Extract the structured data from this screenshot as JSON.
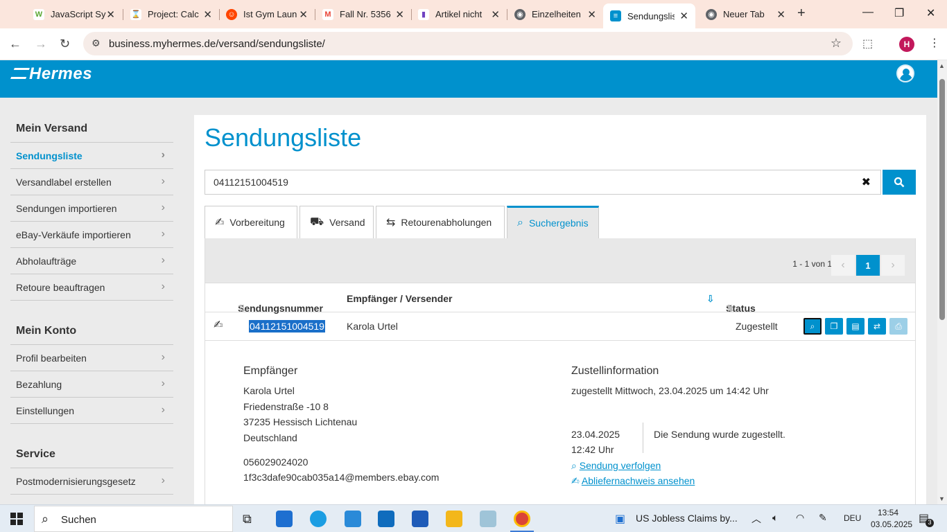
{
  "browser": {
    "tabs": [
      {
        "label": "JavaScript Sy",
        "color": "#5aa832",
        "glyph": "W"
      },
      {
        "label": "Project: Calc",
        "color": "#d9a441",
        "glyph": "P"
      },
      {
        "label": "Ist Gym Laun",
        "color": "#ff4500",
        "glyph": "r"
      },
      {
        "label": "Fall Nr. 5356",
        "color": "#ea4335",
        "glyph": "M"
      },
      {
        "label": "Artikel nicht",
        "color": "#6f42c1",
        "glyph": "A"
      },
      {
        "label": "Einzelheiten",
        "color": "#5f6368",
        "glyph": "G"
      },
      {
        "label": "Sendungsliste",
        "color": "#0091cd",
        "glyph": "H"
      },
      {
        "label": "Neuer Tab",
        "color": "#5f6368",
        "glyph": "G"
      }
    ],
    "url": "business.myhermes.de/versand/sendungsliste/",
    "profile_initial": "H"
  },
  "site": {
    "logo": "Hermes"
  },
  "sidebar": {
    "sections": [
      {
        "title": "Mein Versand",
        "items": [
          "Sendungsliste",
          "Versandlabel erstellen",
          "Sendungen importieren",
          "eBay-Verkäufe importieren",
          "Abholaufträge",
          "Retoure beauftragen"
        ]
      },
      {
        "title": "Mein Konto",
        "items": [
          "Profil bearbeiten",
          "Bezahlung",
          "Einstellungen"
        ]
      },
      {
        "title": "Service",
        "items": [
          "Postmodernisierungsgesetz"
        ]
      }
    ]
  },
  "main": {
    "title": "Sendungsliste",
    "search_value": "04112151004519",
    "tabs": [
      "Vorbereitung",
      "Versand",
      "Retourenabholungen",
      "Suchergebnis"
    ],
    "pagination": {
      "info": "1 - 1 von 1",
      "current": "1"
    },
    "columns": {
      "number": "Sendungsnummer",
      "recipient": "Empfänger / Versender",
      "status": "Status"
    },
    "row": {
      "number": "04112151004519",
      "recipient": "Karola Urtel",
      "status": "Zugestellt"
    },
    "details": {
      "recipient_heading": "Empfänger",
      "name": "Karola Urtel",
      "street": "Friedenstraße -10 8",
      "city": "37235 Hessisch Lichtenau",
      "country": "Deutschland",
      "phone": "056029024020",
      "email": "1f3c3dafe90cab035a14@members.ebay.com",
      "delivery_heading": "Zustellinformation",
      "delivery_summary": "zugestellt Mittwoch, 23.04.2025 um 14:42 Uhr",
      "event_date": "23.04.2025",
      "event_time": "12:42 Uhr",
      "event_text": "Die Sendung wurde zugestellt.",
      "track_link": "Sendung verfolgen",
      "proof_link": "Abliefernachweis ansehen"
    }
  },
  "taskbar": {
    "search": "Suchen",
    "news": "US Jobless Claims by...",
    "lang": "DEU",
    "time": "13:54",
    "date": "03.05.2025",
    "notif_count": "3"
  }
}
